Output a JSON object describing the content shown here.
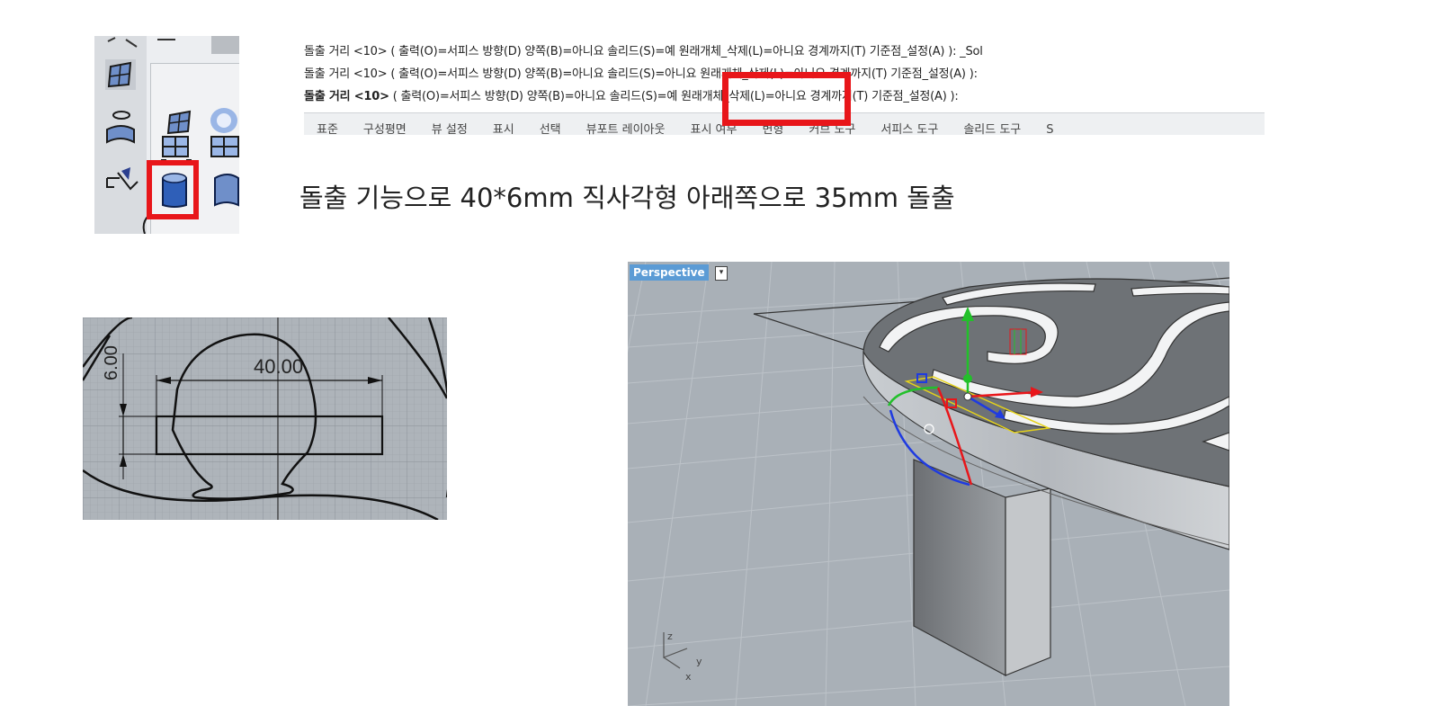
{
  "command_history": {
    "line1": "돌출 거리 <10> ( 출력(O)=서피스  방향(D)  양쪽(B)=아니요  솔리드(S)=예  원래개체_삭제(L)=아니요  경계까지(T)  기준점_설정(A) ): _Sol",
    "line2": "돌출 거리 <10> ( 출력(O)=서피스  방향(D)  양쪽(B)=아니요  솔리드(S)=아니요  원래개체_삭제(L)=아니요  경계까지(T)  기준점_설정(A) ):",
    "line3_prompt": "돌출 거리 <10>",
    "line3_rest": " ( 출력(O)=서피스  방향(D)  양쪽(B)=아니요  솔리드(S)=예  원래개체_삭제(L)=아니요  경계까지(T)  기준점_설정(A) ):"
  },
  "tabs": [
    "표준",
    "구성평면",
    "뷰 설정",
    "표시",
    "선택",
    "뷰포트 레이아웃",
    "표시 여부",
    "변형",
    "커브 도구",
    "서피스 도구",
    "솔리드 도구",
    "S"
  ],
  "caption": "돌출 기능으로   40*6mm 직사각형 아래쪽으로 35mm 돌출",
  "sketch": {
    "dim_width": "40.00",
    "dim_height": "6.00"
  },
  "viewport": {
    "title": "Perspective",
    "dropdown_glyph": "▾",
    "axis_labels": {
      "z": "z",
      "y": "y",
      "x": "x"
    }
  },
  "colors": {
    "highlight": "#e8161a",
    "viewport_title_bg": "#5b9bd5",
    "gumball_x": "#e8161a",
    "gumball_y": "#22c02a",
    "gumball_z": "#1f3be0"
  },
  "icons": [
    "lattice-icon",
    "surface-icon",
    "sphere-icon",
    "cylinder-surface-icon",
    "grid-plane-icon",
    "extrude-solid-icon",
    "extrude-surface-icon",
    "pointer-icon"
  ]
}
